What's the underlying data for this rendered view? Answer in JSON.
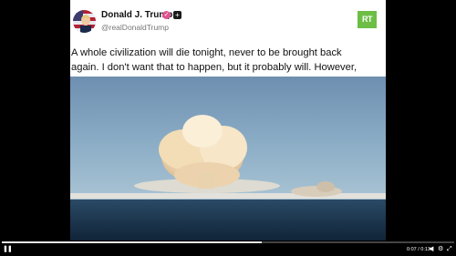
{
  "post": {
    "author": {
      "display_name": "Donald J. Trump",
      "handle": "@realDonaldTrump",
      "verified_icon": "verified-badge-icon",
      "follow_icon": "plus-icon"
    },
    "source_logo": {
      "text": "RT",
      "color": "#6cbe45"
    },
    "text_lines": [
      "A whole civilization will die tonight, never to be brought back",
      "again. I don't want that to happen, but it probably will. However,"
    ],
    "media": {
      "icon": "explosion-video-frame"
    }
  },
  "video_controls": {
    "progress": 0.575,
    "play_icon": "pause-icon",
    "time": "0:07 / 0:13",
    "volume_icon": "volume-icon",
    "settings_icon": "gear-icon",
    "fullscreen_icon": "fullscreen-icon"
  }
}
